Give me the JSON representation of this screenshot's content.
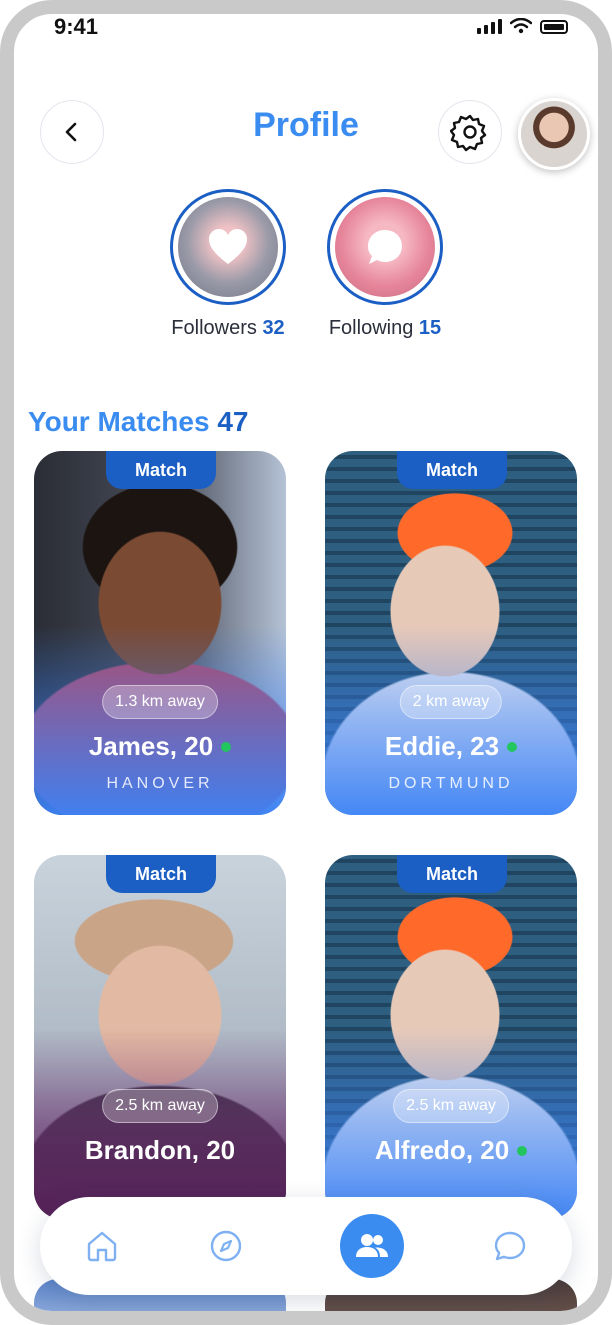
{
  "status_bar": {
    "time": "9:41"
  },
  "header": {
    "title": "Profile"
  },
  "stats": {
    "followers": {
      "label": "Followers",
      "count": "32"
    },
    "following": {
      "label": "Following",
      "count": "15"
    }
  },
  "matches": {
    "title": "Your Matches",
    "count": "47",
    "cards": [
      {
        "tag": "Match",
        "distance": "1.3 km away",
        "name": "James, 20",
        "city": "HANOVER",
        "online": true
      },
      {
        "tag": "Match",
        "distance": "2 km away",
        "name": "Eddie, 23",
        "city": "DORTMUND",
        "online": true
      },
      {
        "tag": "Match",
        "distance": "2.5 km away",
        "name": "Brandon, 20",
        "city": "",
        "online": false
      },
      {
        "tag": "Match",
        "distance": "2.5 km away",
        "name": "Alfredo, 20",
        "city": "",
        "online": true
      }
    ]
  },
  "bottom_nav": {
    "items": [
      {
        "icon": "home-icon",
        "active": false
      },
      {
        "icon": "compass-icon",
        "active": false
      },
      {
        "icon": "users-icon",
        "active": true
      },
      {
        "icon": "chat-icon",
        "active": false
      }
    ]
  },
  "colors": {
    "accent": "#3a8cf0",
    "accent_dark": "#1b5fc4",
    "online": "#22c55e"
  }
}
